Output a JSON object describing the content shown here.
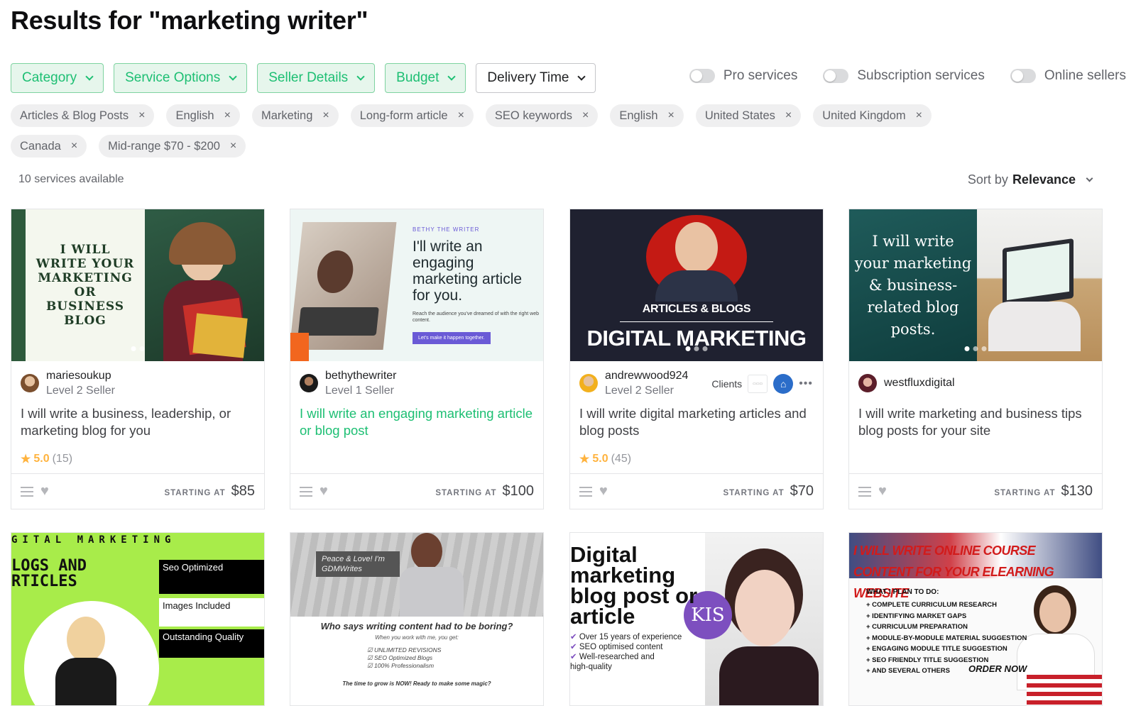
{
  "page": {
    "title": "Results for \"marketing writer\""
  },
  "filters": [
    {
      "label": "Category",
      "active": true
    },
    {
      "label": "Service Options",
      "active": true
    },
    {
      "label": "Seller Details",
      "active": true
    },
    {
      "label": "Budget",
      "active": true
    },
    {
      "label": "Delivery Time",
      "active": false
    }
  ],
  "toggles": [
    {
      "label": "Pro services",
      "on": false
    },
    {
      "label": "Subscription services",
      "on": false
    },
    {
      "label": "Online sellers",
      "on": false
    }
  ],
  "tags": [
    "Articles & Blog Posts",
    "English",
    "Marketing",
    "Long-form article",
    "SEO keywords",
    "English",
    "United States",
    "United Kingdom",
    "Canada",
    "Mid-range $70 - $200"
  ],
  "tag_remove_glyph": "×",
  "results": {
    "count_text": "10 services available",
    "sort_label": "Sort by",
    "sort_value": "Relevance"
  },
  "starting_at_label": "STARTING AT",
  "gigs": [
    {
      "seller": "mariesoukup",
      "level": "Level 2 Seller",
      "title": "I will write a business, leadership, or marketing blog for you",
      "rating": "5.0",
      "reviews": "(15)",
      "price": "$85",
      "thumb_text": "I WILL WRITE YOUR MARKETING OR BUSINESS BLOG"
    },
    {
      "seller": "bethythewriter",
      "level": "Level 1 Seller",
      "title": "I will write an engaging marketing article or blog post",
      "price": "$100",
      "thumb_kicker": "BETHY THE WRITER",
      "thumb_text": "I'll write an engaging marketing article for you.",
      "thumb_sub": "Reach the audience you've dreamed of with the right web content.",
      "thumb_cta": "Let's make it happen together."
    },
    {
      "seller": "andrewwood924",
      "level": "Level 2 Seller",
      "title": "I will write digital marketing articles and blog posts",
      "rating": "5.0",
      "reviews": "(45)",
      "price": "$70",
      "clients_label": "Clients",
      "thumb_text_small": "ARTICLES & BLOGS",
      "thumb_text": "DIGITAL MARKETING"
    },
    {
      "seller": "westfluxdigital",
      "title": "I will write marketing and business tips blog posts for your site",
      "price": "$130",
      "thumb_text": "I will write your marketing & business-related blog posts."
    }
  ],
  "bottom_gigs": [
    {
      "top_text": "GITAL MARKETING",
      "big_text": "LOGS AND RTICLES",
      "boxes": [
        "Seo Optimized",
        "Images Included",
        "Outstanding Quality"
      ]
    },
    {
      "badge": "Peace & Love! I'm GDMWrites",
      "headline": "Who says writing content had to be boring?",
      "sub": "When you work with me, you get:",
      "checks": [
        "UNLIMITED REVISIONS",
        "SEO Optimized Blogs",
        "100% Professionalism"
      ],
      "footer": "The time to grow is NOW! Ready to make some magic?"
    },
    {
      "headline": "Digital marketing blog post or article",
      "bullets": [
        "Over 15 years of experience",
        "SEO optimised content",
        "Well-researched and high-quality"
      ],
      "logo": "KIS"
    },
    {
      "headline": "I WILL WRITE ONLINE COURSE CONTENT FOR YOUR ELEARNING WEBSITE",
      "plan_title": "WHAT I PLAN TO DO:",
      "plan": [
        "+ COMPLETE CURRICULUM RESEARCH",
        "+ IDENTIFYING MARKET GAPS",
        "+ CURRICULUM PREPARATION",
        "+ MODULE-BY-MODULE MATERIAL SUGGESTION",
        "+ ENGAGING MODULE TITLE SUGGESTION",
        "+ SEO FRIENDLY TITLE SUGGESTION",
        "+ AND SEVERAL OTHERS"
      ],
      "cta": "ORDER NOW"
    }
  ],
  "colors": {
    "green": "#1dbf73",
    "star": "#ffb33e"
  }
}
